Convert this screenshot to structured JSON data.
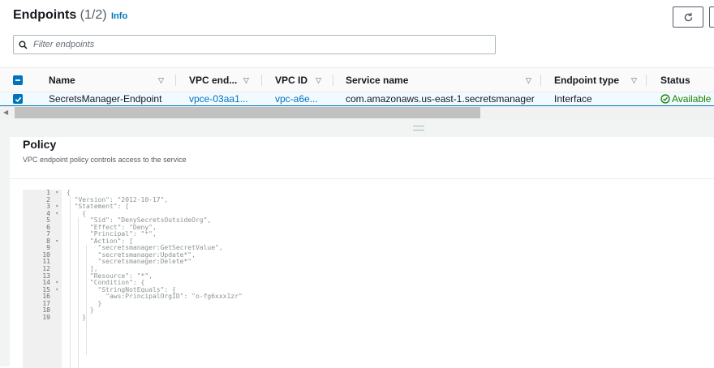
{
  "header": {
    "title": "Endpoints",
    "count": "(1/2)",
    "info_link": "Info"
  },
  "filter": {
    "placeholder": "Filter endpoints"
  },
  "table": {
    "columns": [
      "Name",
      "VPC end...",
      "VPC ID",
      "Service name",
      "Endpoint type",
      "Status"
    ],
    "rows": [
      {
        "name": "SecretsManager-Endpoint",
        "vpc_endpoint_id": "vpce-03aa1...",
        "vpc_id": "vpc-a6e...",
        "service_name": "com.amazonaws.us-east-1.secretsmanager",
        "endpoint_type": "Interface",
        "status": "Available"
      }
    ]
  },
  "policy": {
    "title": "Policy",
    "description": "VPC endpoint policy controls access to the service",
    "line_numbers": [
      "1",
      "2",
      "3",
      "4",
      "5",
      "6",
      "7",
      "8",
      "9",
      "10",
      "11",
      "12",
      "13",
      "14",
      "15",
      "16",
      "17",
      "18",
      "19"
    ],
    "code_lines": [
      "{",
      "  \"Version\": \"2012-10-17\",",
      "  \"Statement\": [",
      "    {",
      "      \"Sid\": \"DenySecretsOutsideOrg\",",
      "      \"Effect\": \"Deny\",",
      "      \"Principal\": \"*\",",
      "      \"Action\": [",
      "        \"secretsmanager:GetSecretValue\",",
      "        \"secretsmanager:Update*\",",
      "        \"secretsmanager:Delete*\"",
      "      ],",
      "      \"Resource\": \"*\",",
      "      \"Condition\": {",
      "        \"StringNotEquals\": {",
      "          \"aws:PrincipalOrgID\": \"o-fg6xxx1zr\"",
      "        }",
      "      }",
      "    }"
    ]
  },
  "colors": {
    "accent": "#0073bb",
    "success": "#1d8102"
  },
  "icons": {
    "refresh": "refresh-icon",
    "search": "search-icon",
    "status": "check-circle-icon"
  }
}
